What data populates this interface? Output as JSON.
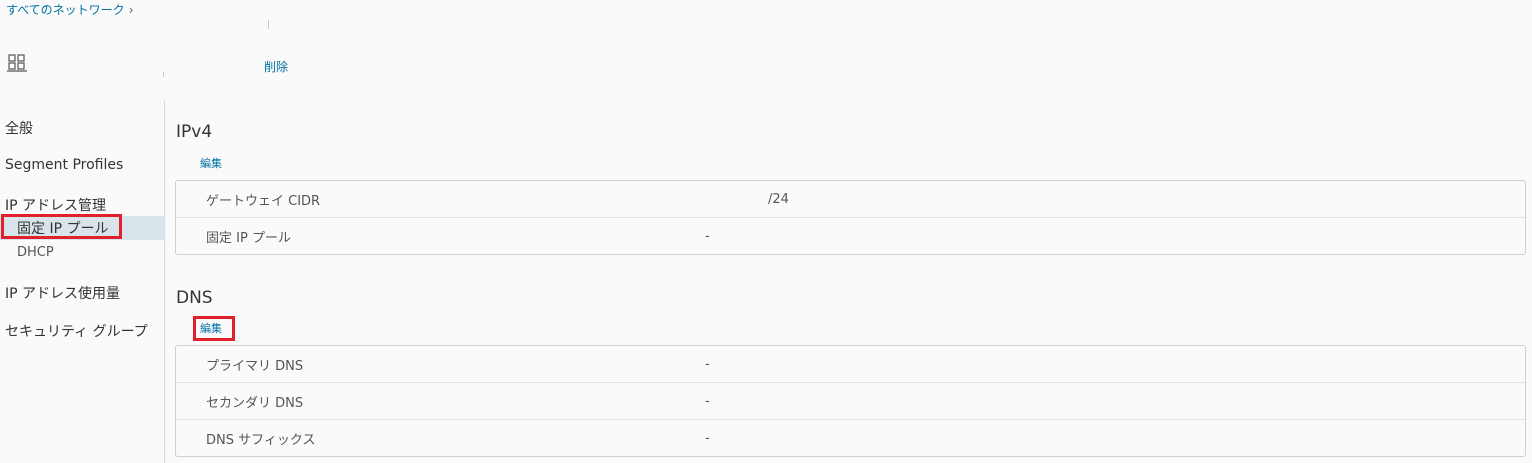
{
  "breadcrumb": {
    "label": "すべてのネットワーク",
    "chevron": "›"
  },
  "toolbar": {
    "delete_label": "削除",
    "grid_icon": "grid-layout-icon"
  },
  "nav": {
    "general": "全般",
    "segment_profiles": "Segment Profiles",
    "ip_management": "IP アドレス管理",
    "static_ip_pool": "固定 IP プール",
    "dhcp": "DHCP",
    "ip_usage": "IP アドレス使用量",
    "security_group": "セキュリティ グループ"
  },
  "ipv4": {
    "title": "IPv4",
    "edit_label": "編集",
    "rows": [
      {
        "label": "ゲートウェイ CIDR",
        "value": "/24"
      },
      {
        "label": "固定 IP プール",
        "value": "-"
      }
    ]
  },
  "dns": {
    "title": "DNS",
    "edit_label": "編集",
    "rows": [
      {
        "label": "プライマリ DNS",
        "value": "-"
      },
      {
        "label": "セカンダリ DNS",
        "value": "-"
      },
      {
        "label": "DNS サフィックス",
        "value": "-"
      }
    ]
  },
  "colors": {
    "link": "#0072a3",
    "highlight": "#e0202a",
    "active_bg": "#d9e4ea"
  }
}
